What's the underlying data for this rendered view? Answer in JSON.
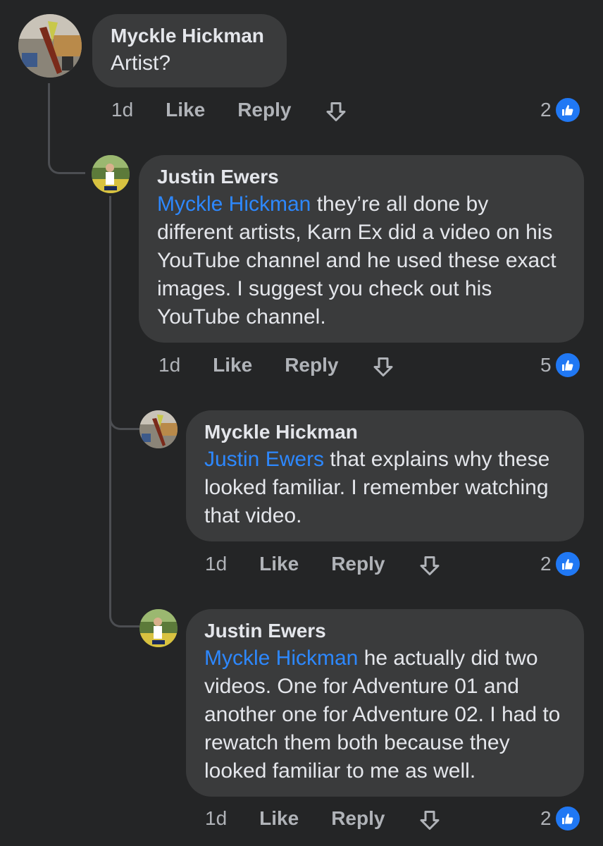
{
  "comments": [
    {
      "author": "Myckle Hickman",
      "mention": "",
      "text": "Artist?",
      "time": "1d",
      "like_label": "Like",
      "reply_label": "Reply",
      "reaction_count": "2",
      "reaction_icon": "thumbs-up-icon"
    },
    {
      "author": "Justin Ewers",
      "mention": "Myckle Hickman",
      "text": "they’re all done by different artists, Karn Ex did a video on his YouTube channel and he used these exact images. I suggest you check out his YouTube channel.",
      "time": "1d",
      "like_label": "Like",
      "reply_label": "Reply",
      "reaction_count": "5",
      "reaction_icon": "thumbs-up-icon"
    },
    {
      "author": "Myckle Hickman",
      "mention": "Justin Ewers",
      "text": "that explains why these looked familiar. I remember watching that video.",
      "time": "1d",
      "like_label": "Like",
      "reply_label": "Reply",
      "reaction_count": "2",
      "reaction_icon": "thumbs-up-icon"
    },
    {
      "author": "Justin Ewers",
      "mention": "Myckle Hickman",
      "text": "he actually did two videos. One for Adventure 01 and another one for Adventure 02. I had to rewatch them both because they looked familiar to me as well.",
      "time": "1d",
      "like_label": "Like",
      "reply_label": "Reply",
      "reaction_count": "2",
      "reaction_icon": "thumbs-up-icon"
    }
  ],
  "colors": {
    "background": "#242526",
    "bubble": "#3a3b3c",
    "mention": "#2d88ff",
    "like_badge": "#2078f4",
    "secondary_text": "#b0b3b8"
  }
}
